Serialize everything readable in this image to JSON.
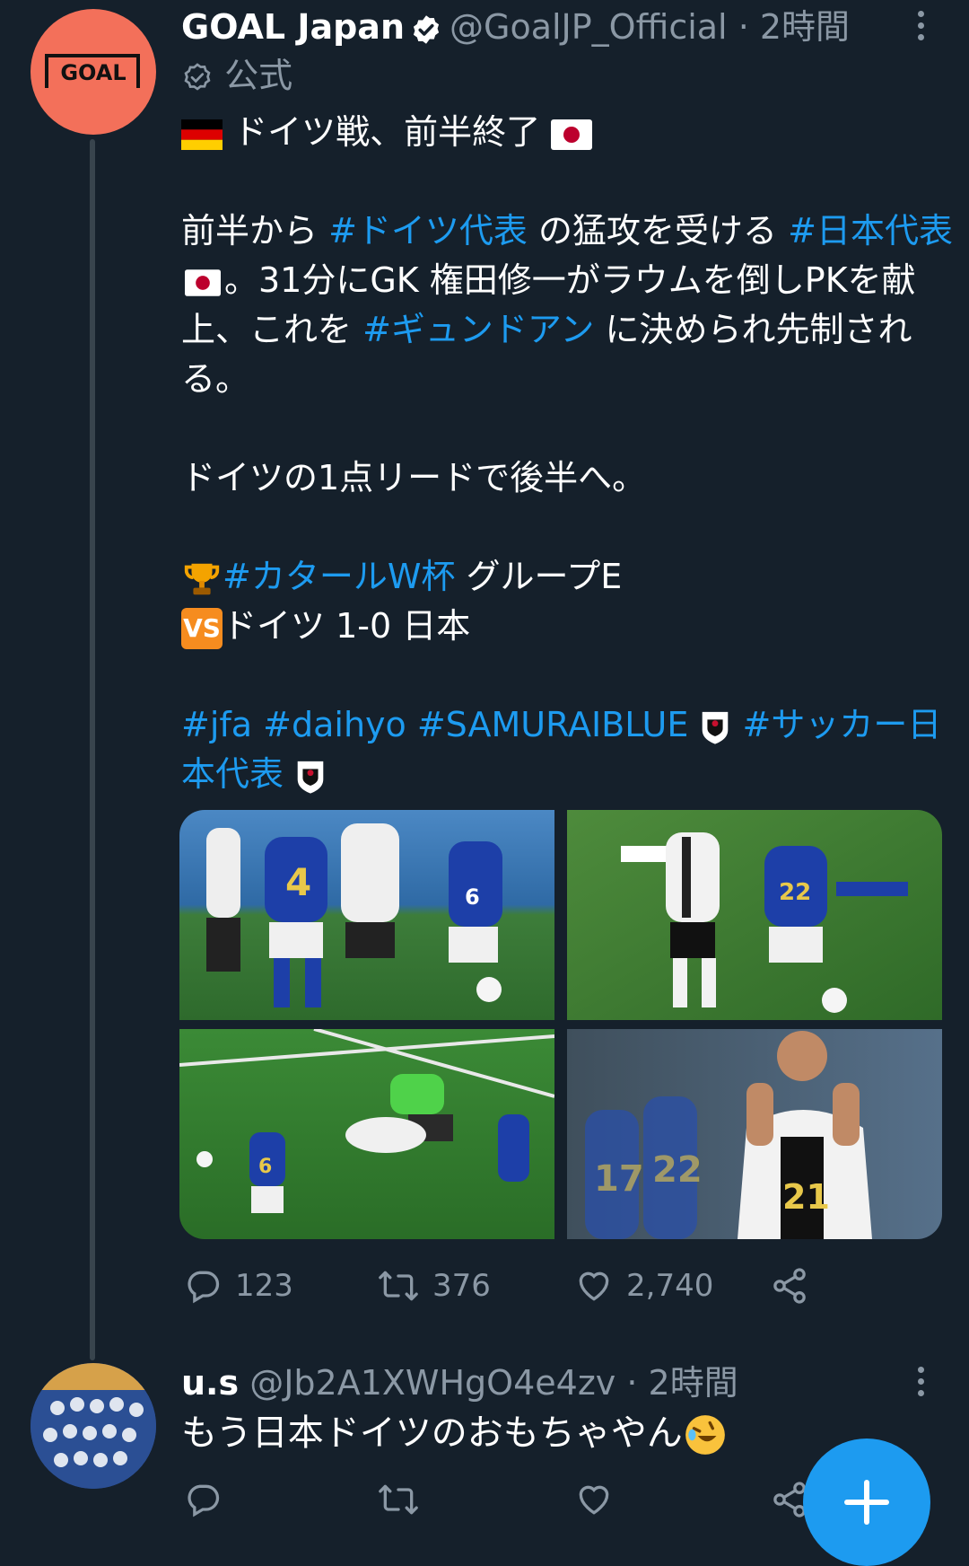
{
  "tweet": {
    "author_name": "GOAL Japan",
    "author_handle": "@GoalJP_Official",
    "time": "· 2時間",
    "label": "公式",
    "avatar_text": "GOAL",
    "line_title": "ドイツ戦、前半終了",
    "p2_a": "前半から ",
    "p2_tag1": "#ドイツ代表",
    "p2_b": " の猛攻を受ける ",
    "p2_tag2": "#日本代表",
    "p2_c": "。31分にGK 権田修一がラウムを倒しPKを献上、これを ",
    "p2_tag3": "#ギュンドアン",
    "p2_d": " に決められ先制される。",
    "p3": "ドイツの1点リードで後半へ。",
    "p4_tag": "#カタールW杯",
    "p4_rest": " グループE",
    "vs_label": "VS",
    "p5_rest": "ドイツ 1-0 日本",
    "tags_a": "#jfa #daihyo #SAMURAIBLUE",
    "tags_b": "#サッカー日本代表",
    "reply_count": "123",
    "retweet_count": "376",
    "like_count": "2,740"
  },
  "reply": {
    "author_name": "u.s",
    "author_handle": "@Jb2A1XWHgO4e4zv",
    "time": "· 2時間",
    "text": "もう日本ドイツのおもちゃやん"
  },
  "colors": {
    "background": "#15202b",
    "link": "#1d9bf0",
    "secondary_text": "#8b98a5",
    "avatar_brand": "#f3705a"
  }
}
